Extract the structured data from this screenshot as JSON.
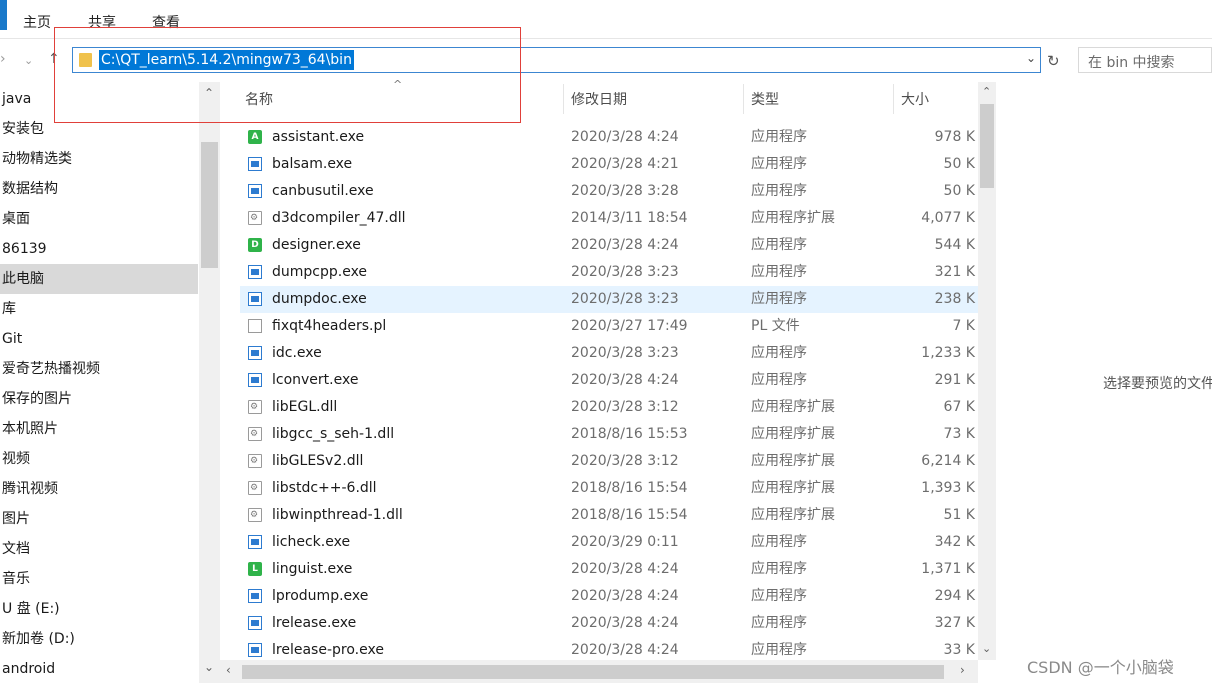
{
  "ribbon": {
    "tabs": [
      "主页",
      "共享",
      "查看"
    ]
  },
  "address": {
    "path": "C:\\QT_learn\\5.14.2\\mingw73_64\\bin"
  },
  "search": {
    "placeholder": "在 bin 中搜索"
  },
  "sidebar": {
    "items": [
      {
        "label": "java",
        "icon": "folder-icon",
        "color": "#e8b93b"
      },
      {
        "label": "安装包",
        "icon": "folder-icon",
        "color": "#e8b93b"
      },
      {
        "label": "动物精选类",
        "icon": "folder-icon",
        "color": "#e8b93b"
      },
      {
        "label": "数据结构",
        "icon": "folder-icon",
        "color": "#e8b93b"
      },
      {
        "label": "桌面",
        "icon": "desktop-icon",
        "color": "#3a8ee6"
      },
      {
        "label": "86139",
        "icon": "user-icon",
        "color": "#8a8a8a"
      },
      {
        "label": "此电脑",
        "icon": "computer-icon",
        "color": "#3a8ee6"
      },
      {
        "label": "库",
        "icon": "library-icon",
        "color": "#3a8ee6"
      },
      {
        "label": "Git",
        "icon": "git-icon",
        "color": "#e8b93b"
      },
      {
        "label": "爱奇艺热播视频",
        "icon": "video-icon",
        "color": "#2fb34a"
      },
      {
        "label": "保存的图片",
        "icon": "picture-icon",
        "color": "#3a8ee6"
      },
      {
        "label": "本机照片",
        "icon": "picture-icon",
        "color": "#3a8ee6"
      },
      {
        "label": "视频",
        "icon": "video-icon",
        "color": "#3a8ee6"
      },
      {
        "label": "腾讯视频",
        "icon": "folder-icon",
        "color": "#e8b93b"
      },
      {
        "label": "图片",
        "icon": "picture-icon",
        "color": "#3a8ee6"
      },
      {
        "label": "文档",
        "icon": "document-icon",
        "color": "#3a8ee6"
      },
      {
        "label": "音乐",
        "icon": "music-icon",
        "color": "#3a8ee6"
      },
      {
        "label": "U 盘 (E:)",
        "icon": "drive-icon",
        "color": "#8a8a8a"
      },
      {
        "label": "新加卷 (D:)",
        "icon": "drive-icon",
        "color": "#8a8a8a"
      },
      {
        "label": "android",
        "icon": "folder-icon",
        "color": "#e8b93b"
      }
    ],
    "selected_index": 6
  },
  "list": {
    "columns": {
      "name": "名称",
      "date": "修改日期",
      "type": "类型",
      "size": "大小"
    },
    "rows": [
      {
        "name": "assistant.exe",
        "date": "2020/3/28 4:24",
        "type": "应用程序",
        "size": "978 K",
        "icon": "green",
        "letter": "A"
      },
      {
        "name": "balsam.exe",
        "date": "2020/3/28 4:21",
        "type": "应用程序",
        "size": "50 K",
        "icon": "exe",
        "letter": ""
      },
      {
        "name": "canbusutil.exe",
        "date": "2020/3/28 3:28",
        "type": "应用程序",
        "size": "50 K",
        "icon": "exe",
        "letter": ""
      },
      {
        "name": "d3dcompiler_47.dll",
        "date": "2014/3/11 18:54",
        "type": "应用程序扩展",
        "size": "4,077 K",
        "icon": "dll",
        "letter": ""
      },
      {
        "name": "designer.exe",
        "date": "2020/3/28 4:24",
        "type": "应用程序",
        "size": "544 K",
        "icon": "green",
        "letter": "D"
      },
      {
        "name": "dumpcpp.exe",
        "date": "2020/3/28 3:23",
        "type": "应用程序",
        "size": "321 K",
        "icon": "exe",
        "letter": ""
      },
      {
        "name": "dumpdoc.exe",
        "date": "2020/3/28 3:23",
        "type": "应用程序",
        "size": "238 K",
        "icon": "exe",
        "letter": ""
      },
      {
        "name": "fixqt4headers.pl",
        "date": "2020/3/27 17:49",
        "type": "PL 文件",
        "size": "7 K",
        "icon": "file",
        "letter": ""
      },
      {
        "name": "idc.exe",
        "date": "2020/3/28 3:23",
        "type": "应用程序",
        "size": "1,233 K",
        "icon": "exe",
        "letter": ""
      },
      {
        "name": "lconvert.exe",
        "date": "2020/3/28 4:24",
        "type": "应用程序",
        "size": "291 K",
        "icon": "exe",
        "letter": ""
      },
      {
        "name": "libEGL.dll",
        "date": "2020/3/28 3:12",
        "type": "应用程序扩展",
        "size": "67 K",
        "icon": "dll",
        "letter": ""
      },
      {
        "name": "libgcc_s_seh-1.dll",
        "date": "2018/8/16 15:53",
        "type": "应用程序扩展",
        "size": "73 K",
        "icon": "dll",
        "letter": ""
      },
      {
        "name": "libGLESv2.dll",
        "date": "2020/3/28 3:12",
        "type": "应用程序扩展",
        "size": "6,214 K",
        "icon": "dll",
        "letter": ""
      },
      {
        "name": "libstdc++-6.dll",
        "date": "2018/8/16 15:54",
        "type": "应用程序扩展",
        "size": "1,393 K",
        "icon": "dll",
        "letter": ""
      },
      {
        "name": "libwinpthread-1.dll",
        "date": "2018/8/16 15:54",
        "type": "应用程序扩展",
        "size": "51 K",
        "icon": "dll",
        "letter": ""
      },
      {
        "name": "licheck.exe",
        "date": "2020/3/29 0:11",
        "type": "应用程序",
        "size": "342 K",
        "icon": "exe",
        "letter": ""
      },
      {
        "name": "linguist.exe",
        "date": "2020/3/28 4:24",
        "type": "应用程序",
        "size": "1,371 K",
        "icon": "green",
        "letter": "L"
      },
      {
        "name": "lprodump.exe",
        "date": "2020/3/28 4:24",
        "type": "应用程序",
        "size": "294 K",
        "icon": "exe",
        "letter": ""
      },
      {
        "name": "lrelease.exe",
        "date": "2020/3/28 4:24",
        "type": "应用程序",
        "size": "327 K",
        "icon": "exe",
        "letter": ""
      },
      {
        "name": "lrelease-pro.exe",
        "date": "2020/3/28 4:24",
        "type": "应用程序",
        "size": "33 K",
        "icon": "exe",
        "letter": ""
      }
    ],
    "highlighted_index": 6
  },
  "preview": {
    "text": "选择要预览的文件"
  },
  "watermark": "CSDN @一个小脑袋"
}
